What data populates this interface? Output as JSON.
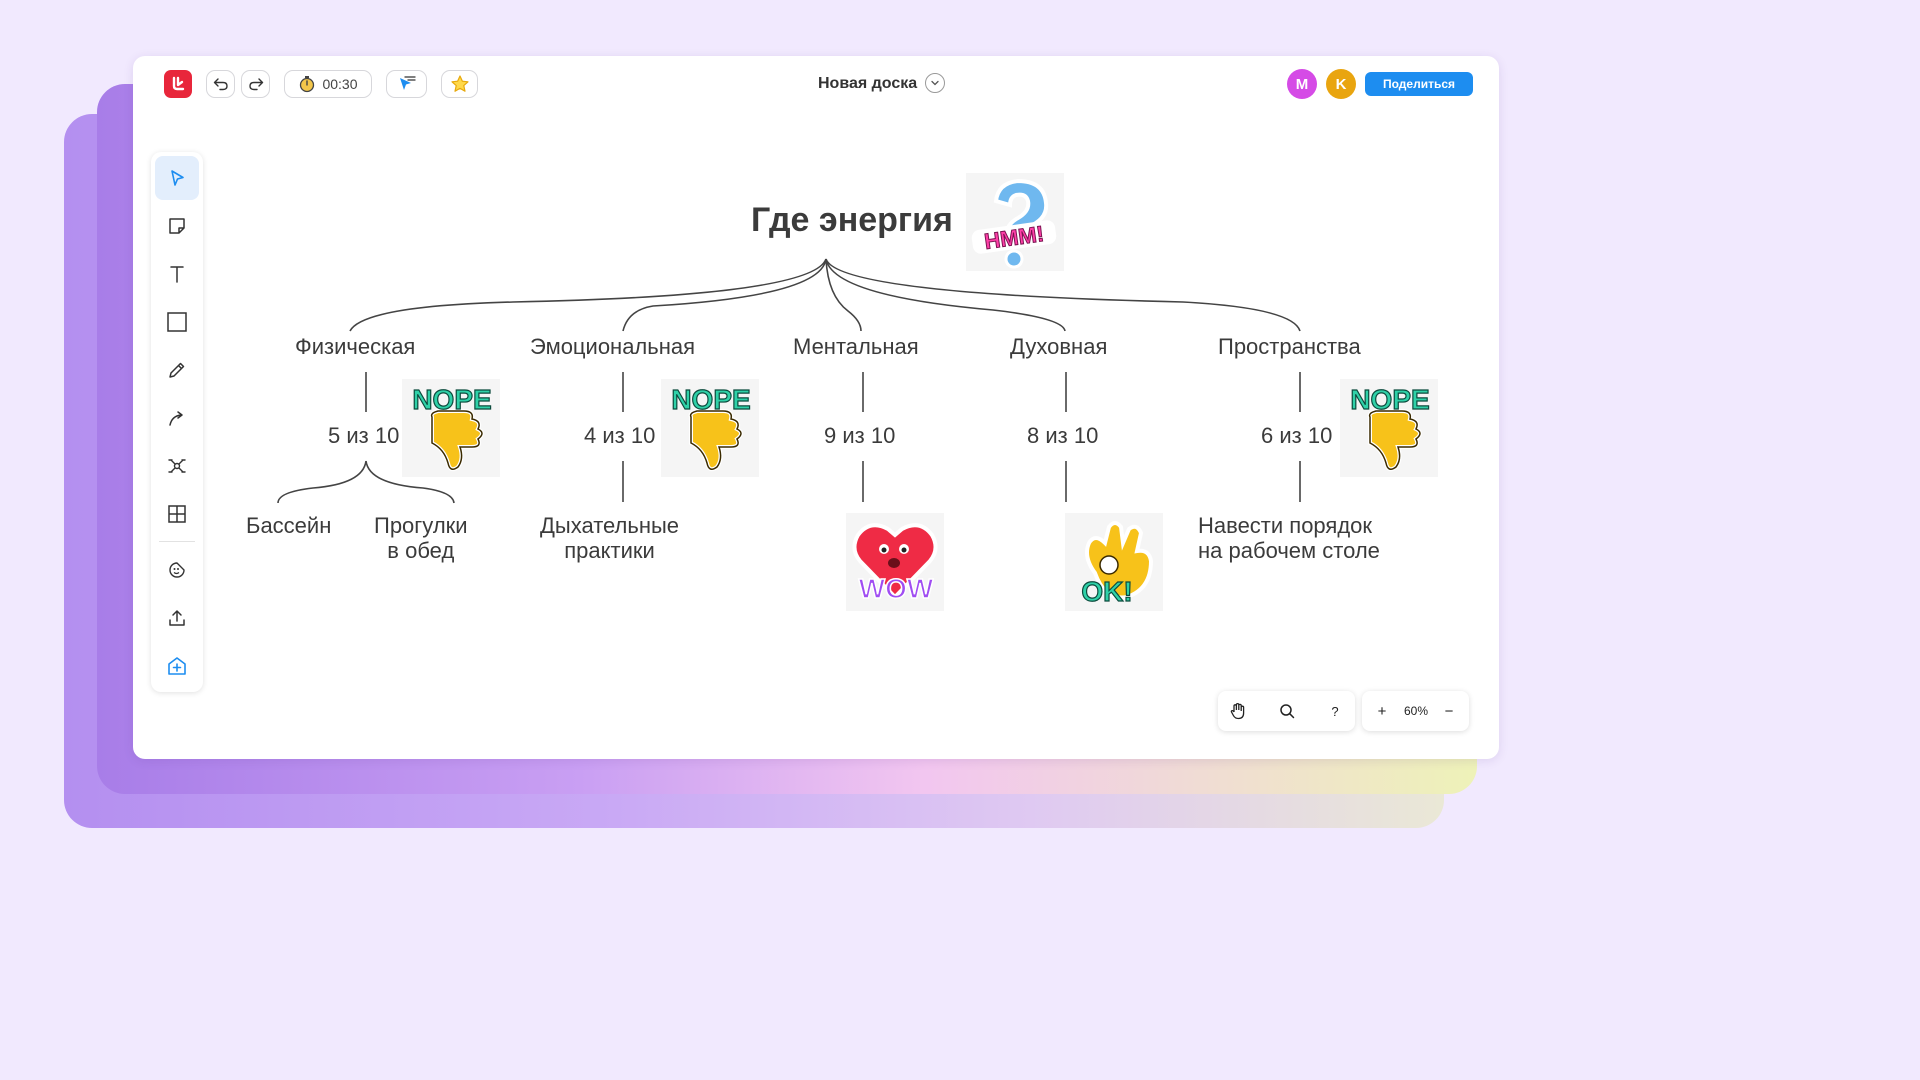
{
  "app": {
    "timer": "00:30",
    "board_title": "Новая доска",
    "share_label": "Поделиться",
    "avatars": [
      {
        "initial": "M",
        "color": "#d54be6"
      },
      {
        "initial": "K",
        "color": "#e9a50f"
      }
    ]
  },
  "toolbar": {
    "tools": [
      "select-tool",
      "sticky-note-tool",
      "text-tool",
      "shape-tool",
      "pen-tool",
      "connector-tool",
      "mindmap-tool",
      "table-tool",
      "sticker-tool",
      "upload-tool",
      "add-board-tool"
    ]
  },
  "mindmap": {
    "root": "Где энергия",
    "branches": [
      {
        "label": "Физическая",
        "score": "5 из 10",
        "sticker": "nope",
        "leaves": [
          "Бассейн",
          "Прогулки\nв обед"
        ]
      },
      {
        "label": "Эмоциональная",
        "score": "4 из 10",
        "sticker": "nope",
        "leaves": [
          "Дыхательные\nпрактики"
        ]
      },
      {
        "label": "Ментальная",
        "score": "9 из 10",
        "sticker": "wow",
        "leaves": []
      },
      {
        "label": "Духовная",
        "score": "8 из 10",
        "sticker": "ok",
        "leaves": []
      },
      {
        "label": "Пространства",
        "score": "6 из 10",
        "sticker": "nope",
        "leaves": [
          "Навести порядок\nна рабочем столе"
        ]
      }
    ],
    "root_sticker": "hmm",
    "sticker_texts": {
      "nope": "NOPE",
      "wow": "WOW",
      "ok": "OK!",
      "hmm": "HMM!"
    }
  },
  "controls": {
    "zoom": "60%",
    "help": "?",
    "zoom_in": "+",
    "zoom_out": "−"
  },
  "colors": {
    "accent": "#1d8df0",
    "logo": "#e8263b",
    "background": "#f1e9fe"
  }
}
